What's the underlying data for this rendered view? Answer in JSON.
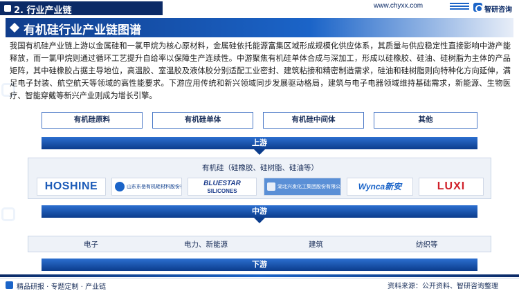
{
  "header": {
    "section_label": "2. 行业产业链",
    "url": "www.chyxx.com",
    "brand_name": "智研咨询"
  },
  "title": "有机硅行业产业链图谱",
  "paragraph": "我国有机硅产业链上游以金属硅和一氯甲烷为核心原材料，金属硅依托能源富集区域形成规模化供应体系，其质量与供应稳定性直接影响中游产能释放，而一氯甲烷则通过循环工艺提升自给率以保障生产连续性。中游聚焦有机硅单体合成与深加工，形成以硅橡胶、硅油、硅树脂为主体的产品矩阵，其中硅橡胶占据主导地位，高温胶、室温胶及液体胶分别适配工业密封、建筑粘接和精密制造需求，硅油和硅树脂则向特种化方向延伸，满足电子封装、航空航天等领域的高性能要求。下游应用传统和新兴领域同步发展驱动格局，建筑与电子电器领域维持基础需求，新能源、生物医疗、智能穿戴等新兴产业则成为增长引擎。",
  "upstream": {
    "items": [
      "有机硅原料",
      "有机硅单体",
      "有机硅中间体",
      "其他"
    ],
    "label": "上游"
  },
  "midstream": {
    "products_label": "有机硅（硅橡胶、硅树脂、硅油等）",
    "companies": [
      {
        "name": "HOSHINE",
        "logo": "hoshine-logo"
      },
      {
        "name": "山东东岳有机硅材料股份有限公司",
        "logo": "dongyue-logo"
      },
      {
        "name": "BLUESTAR",
        "sub": "SILICONES",
        "logo": "bluestar-logo"
      },
      {
        "name": "湖北兴发化工集团股份有限公司",
        "logo": "xingfa-logo"
      },
      {
        "name": "Wynca新安",
        "logo": "wynca-logo"
      },
      {
        "name": "LUXI",
        "logo": "luxi-logo"
      }
    ],
    "label": "中游"
  },
  "downstream": {
    "items": [
      "电子",
      "电力、新能源",
      "建筑",
      "纺织等"
    ],
    "label": "下游"
  },
  "footer": {
    "left_text": "精品研报 · 专题定制 · 产业链",
    "source": "资料来源：公开资料、智研咨询整理"
  },
  "colors": {
    "brand_navy": "#0b2a66",
    "brand_blue": "#1b64c8",
    "luxi_red": "#d0202a"
  }
}
